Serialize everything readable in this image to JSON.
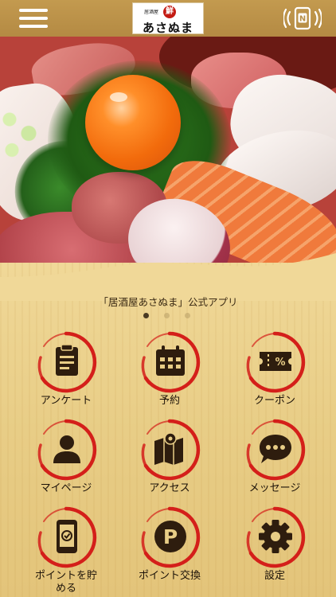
{
  "header": {
    "logo": {
      "subtitle": "居酒屋",
      "badge": "鮮",
      "name": "あさぬま"
    }
  },
  "app_title": "「居酒屋あさぬま」公式アプリ",
  "carousel": {
    "pages": 3,
    "active": 1
  },
  "tiles": [
    {
      "label": "アンケート",
      "icon": "clipboard-icon"
    },
    {
      "label": "予約",
      "icon": "calendar-icon"
    },
    {
      "label": "クーポン",
      "icon": "coupon-ticket-icon"
    },
    {
      "label": "マイページ",
      "icon": "person-icon"
    },
    {
      "label": "アクセス",
      "icon": "map-icon"
    },
    {
      "label": "メッセージ",
      "icon": "chat-bubble-icon"
    },
    {
      "label": "ポイントを貯\nめる",
      "icon": "phone-check-icon"
    },
    {
      "label": "ポイント交換",
      "icon": "points-p-icon"
    },
    {
      "label": "設定",
      "icon": "gear-icon"
    }
  ],
  "colors": {
    "header": "#b8904a",
    "ring": "#d41f1a",
    "icon": "#2e1d0e"
  }
}
